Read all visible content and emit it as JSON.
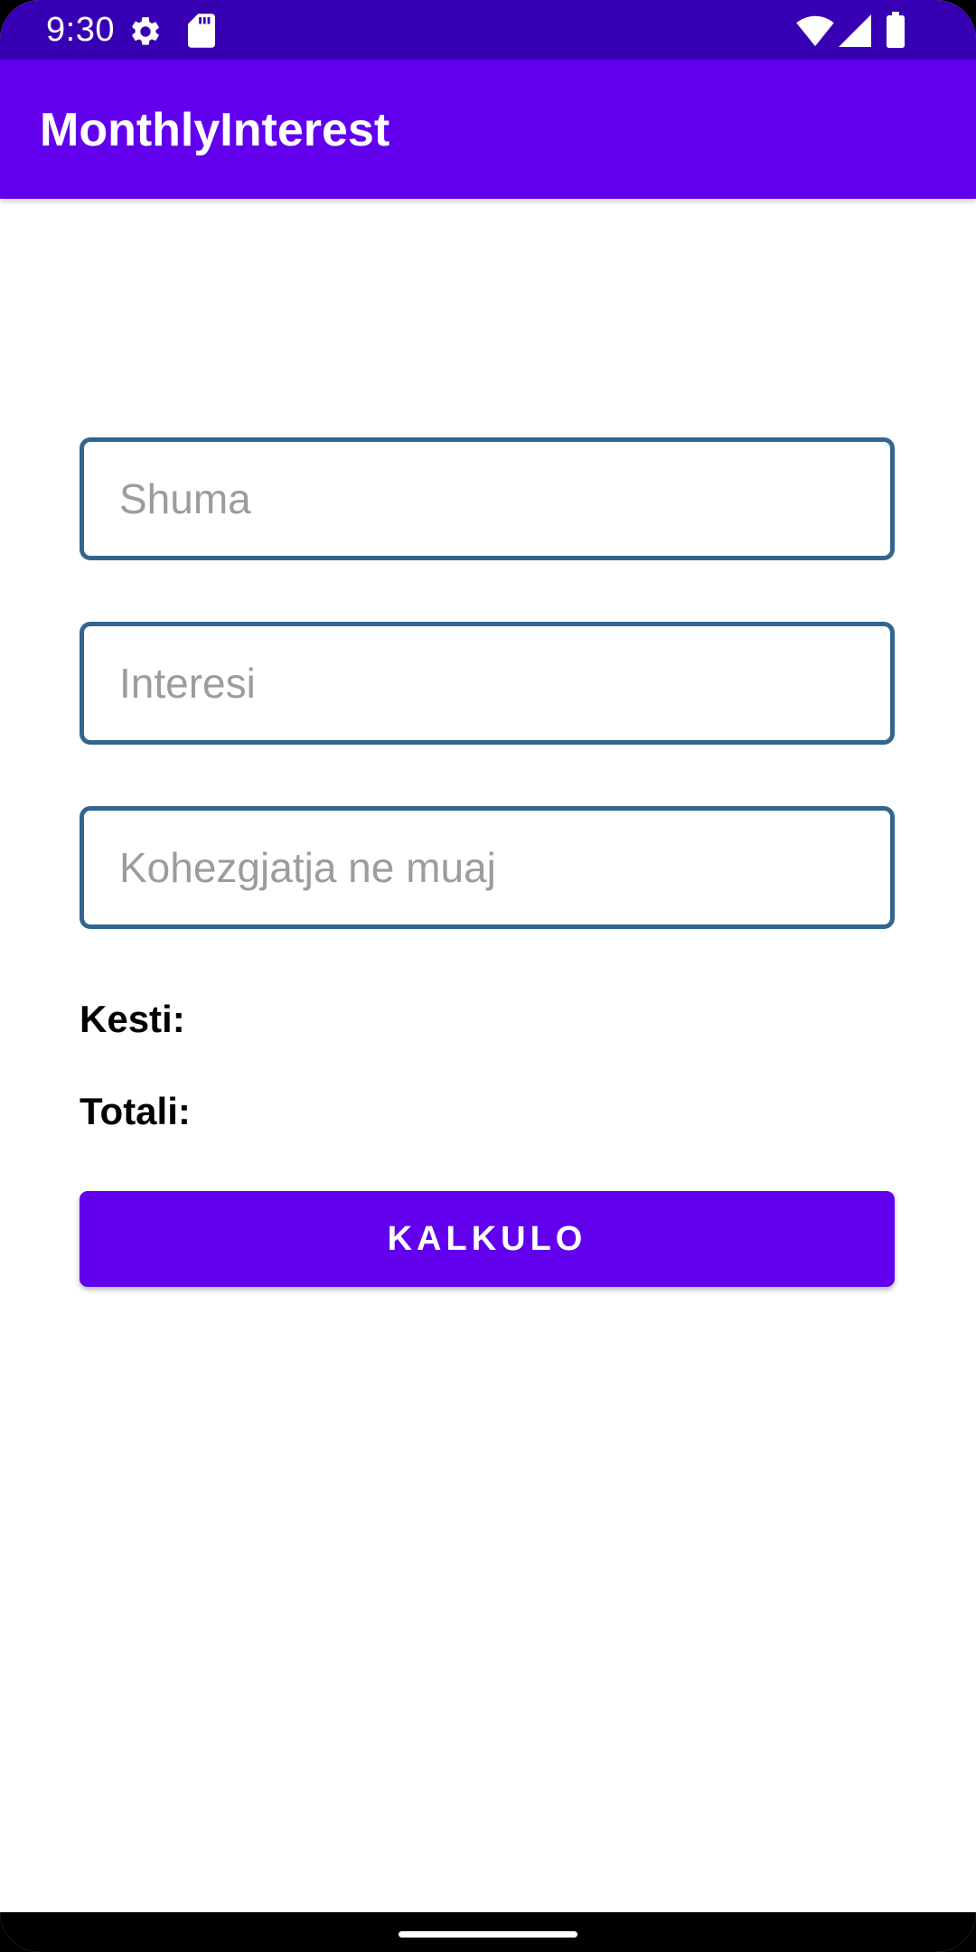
{
  "status_bar": {
    "time": "9:30",
    "icons": [
      "gear-icon",
      "sd-card-icon",
      "wifi-icon",
      "signal-icon",
      "battery-icon"
    ]
  },
  "app_bar": {
    "title": "MonthlyInterest"
  },
  "form": {
    "amount_placeholder": "Shuma",
    "interest_placeholder": "Interesi",
    "duration_placeholder": "Kohezgjatja ne muaj",
    "installment_label": "Kesti:",
    "total_label": "Totali:",
    "calculate_label": "KALKULO"
  },
  "colors": {
    "status_bar": "#3700b3",
    "primary": "#6200ee",
    "field_border": "#33658f",
    "placeholder": "#9c9c9c"
  }
}
